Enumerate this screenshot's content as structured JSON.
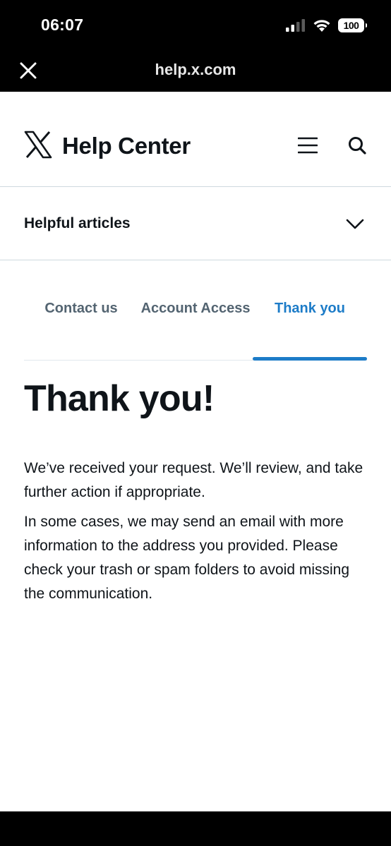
{
  "status_bar": {
    "time": "06:07",
    "battery": "100",
    "icons": [
      "signal-icon",
      "wifi-icon",
      "battery-icon"
    ]
  },
  "browser": {
    "url": "help.x.com",
    "close_icon": "close-icon"
  },
  "site": {
    "title": "Help Center",
    "logo_icon": "x-logo-icon",
    "menu_icon": "menu-icon",
    "search_icon": "search-icon"
  },
  "articles": {
    "label": "Helpful articles",
    "icon": "chevron-down-icon"
  },
  "tabs": [
    {
      "label": "Contact us",
      "active": false
    },
    {
      "label": "Account Access",
      "active": false
    },
    {
      "label": "Thank you",
      "active": true
    }
  ],
  "main": {
    "heading": "Thank you!",
    "paragraphs": [
      "We’ve received your request. We’ll review, and take further action if appropriate.",
      "In some cases, we may send an email with more information to the address you provided. Please check your trash or spam folders to avoid missing the communication."
    ]
  },
  "colors": {
    "accent": "#1d7cc8",
    "text": "#0f1419",
    "muted": "#536471",
    "divider": "#cfd9de"
  }
}
